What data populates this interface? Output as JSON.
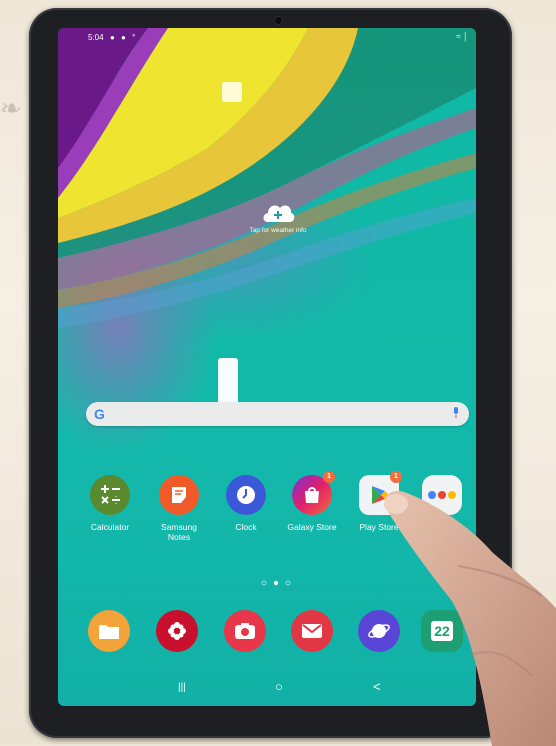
{
  "status_bar": {
    "time": "5:04",
    "notification_icons": "● ● °",
    "right_icons": "≈ │"
  },
  "weather_widget": {
    "icon": "cloud-plus-icon",
    "text": "Tap for weather info"
  },
  "search_bar": {
    "logo": "G",
    "mic_icon": "mic-icon"
  },
  "apps": [
    {
      "label": "Calculator",
      "icon": "calculator-icon",
      "color": "#5a8a2f"
    },
    {
      "label": "Samsung\nNotes",
      "icon": "notes-icon",
      "color": "#f05a28"
    },
    {
      "label": "Clock",
      "icon": "clock-icon",
      "color": "#3b58d9"
    },
    {
      "label": "Galaxy Store",
      "icon": "shopping-bag-icon",
      "color": "#d7206f",
      "badge": "1"
    },
    {
      "label": "Play Store",
      "icon": "play-store-icon",
      "color": "#f1f3f4",
      "badge": "1"
    },
    {
      "label": "",
      "icon": "google-folder-icon",
      "color": "#f1f3f4"
    }
  ],
  "page_indicator": {
    "pages": 3,
    "current": 2
  },
  "dock": [
    {
      "icon": "my-files-icon",
      "color": "#f2a33a"
    },
    {
      "icon": "gallery-icon",
      "color": "#c8102e"
    },
    {
      "icon": "camera-icon",
      "color": "#e8364a"
    },
    {
      "icon": "email-icon",
      "color": "#e23744"
    },
    {
      "icon": "internet-icon",
      "color": "#5a46d6"
    },
    {
      "icon": "calendar-icon",
      "color": "#1e9e73",
      "text": "22"
    }
  ],
  "nav_bar": {
    "recents": "|||",
    "home": "○",
    "back": "<"
  }
}
